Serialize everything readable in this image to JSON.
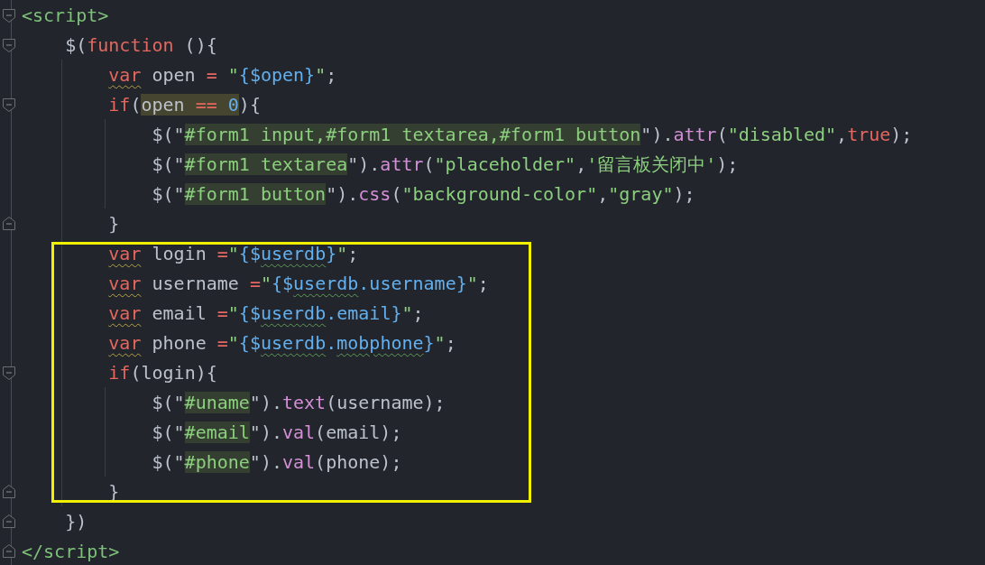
{
  "lines": [
    {
      "kind": "line",
      "fold_start": true,
      "tokens": [
        {
          "text": "<script>",
          "kind": "tag"
        }
      ],
      "children": [
        {
          "kind": "line",
          "fold_start": true,
          "tokens": [
            {
              "text": "$(",
              "kind": "plain"
            },
            {
              "text": "function",
              "kind": "keyword"
            },
            {
              "text": " (){",
              "kind": "plain"
            }
          ],
          "children": [
            {
              "kind": "line",
              "tokens": [
                {
                  "text": "var",
                  "kind": "keyword",
                  "squiggly": true
                },
                {
                  "text": " open ",
                  "kind": "plain"
                },
                {
                  "text": "=",
                  "kind": "keyword"
                },
                {
                  "text": " \"",
                  "kind": "string"
                },
                {
                  "text": "{$open}",
                  "kind": "interp"
                },
                {
                  "text": "\"",
                  "kind": "string"
                },
                {
                  "text": ";",
                  "kind": "plain"
                }
              ]
            },
            {
              "kind": "line",
              "fold_start": true,
              "tokens": [
                {
                  "text": "if",
                  "kind": "keyword"
                },
                {
                  "text": "(",
                  "kind": "plain"
                },
                {
                  "text": "open ",
                  "kind": "plain",
                  "highlighted": true
                },
                {
                  "text": "== ",
                  "kind": "keyword",
                  "highlighted": true
                },
                {
                  "text": "0",
                  "kind": "number",
                  "highlighted": true
                },
                {
                  "text": "){",
                  "kind": "plain"
                }
              ],
              "children": [
                {
                  "kind": "line",
                  "tokens": [
                    {
                      "text": "$(\"",
                      "kind": "plain"
                    },
                    {
                      "text": "#form1 input,#form1 textarea,#form1 button",
                      "kind": "string",
                      "highlighted": true
                    },
                    {
                      "text": "\").",
                      "kind": "plain"
                    },
                    {
                      "text": "attr",
                      "kind": "method"
                    },
                    {
                      "text": "(",
                      "kind": "plain"
                    },
                    {
                      "text": "\"disabled\"",
                      "kind": "string"
                    },
                    {
                      "text": ",",
                      "kind": "plain"
                    },
                    {
                      "text": "true",
                      "kind": "keyword"
                    },
                    {
                      "text": ");",
                      "kind": "plain"
                    }
                  ]
                },
                {
                  "kind": "line",
                  "tokens": [
                    {
                      "text": "$(\"",
                      "kind": "plain"
                    },
                    {
                      "text": "#form1 textarea",
                      "kind": "string",
                      "highlighted": true
                    },
                    {
                      "text": "\").",
                      "kind": "plain"
                    },
                    {
                      "text": "attr",
                      "kind": "method"
                    },
                    {
                      "text": "(",
                      "kind": "plain"
                    },
                    {
                      "text": "\"placeholder\"",
                      "kind": "string"
                    },
                    {
                      "text": ",",
                      "kind": "plain"
                    },
                    {
                      "text": "'留言板关闭中'",
                      "kind": "string"
                    },
                    {
                      "text": ");",
                      "kind": "plain"
                    }
                  ]
                },
                {
                  "kind": "line",
                  "tokens": [
                    {
                      "text": "$(\"",
                      "kind": "plain"
                    },
                    {
                      "text": "#form1 button",
                      "kind": "string",
                      "highlighted": true
                    },
                    {
                      "text": "\").",
                      "kind": "plain"
                    },
                    {
                      "text": "css",
                      "kind": "method"
                    },
                    {
                      "text": "(",
                      "kind": "plain"
                    },
                    {
                      "text": "\"background-color\"",
                      "kind": "string"
                    },
                    {
                      "text": ",",
                      "kind": "plain"
                    },
                    {
                      "text": "\"gray\"",
                      "kind": "string"
                    },
                    {
                      "text": ");",
                      "kind": "plain"
                    }
                  ]
                }
              ]
            },
            {
              "kind": "line",
              "fold_end": true,
              "tokens": [
                {
                  "text": "}",
                  "kind": "plain"
                }
              ]
            },
            {
              "kind": "frame",
              "children": [
                {
                  "kind": "line",
                  "tokens": [
                    {
                      "text": "var",
                      "kind": "keyword",
                      "squiggly": true
                    },
                    {
                      "text": " login ",
                      "kind": "plain"
                    },
                    {
                      "text": "=",
                      "kind": "keyword"
                    },
                    {
                      "text": "\"",
                      "kind": "string"
                    },
                    {
                      "text": "{$",
                      "kind": "interp"
                    },
                    {
                      "text": "userdb",
                      "kind": "interp",
                      "squiggly": true
                    },
                    {
                      "text": "}",
                      "kind": "interp"
                    },
                    {
                      "text": "\"",
                      "kind": "string"
                    },
                    {
                      "text": ";",
                      "kind": "plain"
                    }
                  ]
                },
                {
                  "kind": "line",
                  "tokens": [
                    {
                      "text": "var",
                      "kind": "keyword",
                      "squiggly": true
                    },
                    {
                      "text": " username ",
                      "kind": "plain"
                    },
                    {
                      "text": "=",
                      "kind": "keyword"
                    },
                    {
                      "text": "\"",
                      "kind": "string"
                    },
                    {
                      "text": "{$",
                      "kind": "interp"
                    },
                    {
                      "text": "userdb",
                      "kind": "interp",
                      "squiggly": true
                    },
                    {
                      "text": ".username}",
                      "kind": "interp"
                    },
                    {
                      "text": "\"",
                      "kind": "string"
                    },
                    {
                      "text": ";",
                      "kind": "plain"
                    }
                  ]
                },
                {
                  "kind": "line",
                  "tokens": [
                    {
                      "text": "var",
                      "kind": "keyword",
                      "squiggly": true
                    },
                    {
                      "text": " email ",
                      "kind": "plain"
                    },
                    {
                      "text": "=",
                      "kind": "keyword"
                    },
                    {
                      "text": "\"",
                      "kind": "string"
                    },
                    {
                      "text": "{$",
                      "kind": "interp"
                    },
                    {
                      "text": "userdb",
                      "kind": "interp",
                      "squiggly": true
                    },
                    {
                      "text": ".email}",
                      "kind": "interp"
                    },
                    {
                      "text": "\"",
                      "kind": "string"
                    },
                    {
                      "text": ";",
                      "kind": "plain"
                    }
                  ]
                },
                {
                  "kind": "line",
                  "tokens": [
                    {
                      "text": "var",
                      "kind": "keyword",
                      "squiggly": true
                    },
                    {
                      "text": " phone ",
                      "kind": "plain"
                    },
                    {
                      "text": "=",
                      "kind": "keyword"
                    },
                    {
                      "text": "\"",
                      "kind": "string"
                    },
                    {
                      "text": "{$",
                      "kind": "interp"
                    },
                    {
                      "text": "userdb",
                      "kind": "interp",
                      "squiggly": true
                    },
                    {
                      "text": ".",
                      "kind": "interp"
                    },
                    {
                      "text": "mobphone",
                      "kind": "interp",
                      "squiggly": true
                    },
                    {
                      "text": "}",
                      "kind": "interp"
                    },
                    {
                      "text": "\"",
                      "kind": "string"
                    },
                    {
                      "text": ";",
                      "kind": "plain"
                    }
                  ]
                },
                {
                  "kind": "line",
                  "fold_start": true,
                  "tokens": [
                    {
                      "text": "if",
                      "kind": "keyword"
                    },
                    {
                      "text": "(login){",
                      "kind": "plain"
                    }
                  ],
                  "children": [
                    {
                      "kind": "line",
                      "tokens": [
                        {
                          "text": "$(\"",
                          "kind": "plain"
                        },
                        {
                          "text": "#uname",
                          "kind": "string",
                          "highlighted": true
                        },
                        {
                          "text": "\").",
                          "kind": "plain"
                        },
                        {
                          "text": "text",
                          "kind": "method"
                        },
                        {
                          "text": "(username);",
                          "kind": "plain"
                        }
                      ]
                    },
                    {
                      "kind": "line",
                      "tokens": [
                        {
                          "text": "$(\"",
                          "kind": "plain"
                        },
                        {
                          "text": "#email",
                          "kind": "string",
                          "highlighted": true
                        },
                        {
                          "text": "\").",
                          "kind": "plain"
                        },
                        {
                          "text": "val",
                          "kind": "method"
                        },
                        {
                          "text": "(email);",
                          "kind": "plain"
                        }
                      ]
                    },
                    {
                      "kind": "line",
                      "tokens": [
                        {
                          "text": "$(\"",
                          "kind": "plain"
                        },
                        {
                          "text": "#phone",
                          "kind": "string",
                          "highlighted": true
                        },
                        {
                          "text": "\").",
                          "kind": "plain"
                        },
                        {
                          "text": "val",
                          "kind": "method"
                        },
                        {
                          "text": "(phone);",
                          "kind": "plain"
                        }
                      ]
                    }
                  ]
                },
                {
                  "kind": "line",
                  "fold_end": true,
                  "tokens": [
                    {
                      "text": "}",
                      "kind": "plain"
                    }
                  ]
                }
              ]
            }
          ]
        },
        {
          "kind": "line",
          "fold_end": true,
          "tokens": [
            {
              "text": "})",
              "kind": "plain"
            }
          ]
        }
      ]
    },
    {
      "kind": "line",
      "fold_end": true,
      "tokens": [
        {
          "text": "</script>",
          "kind": "tag"
        }
      ]
    }
  ]
}
